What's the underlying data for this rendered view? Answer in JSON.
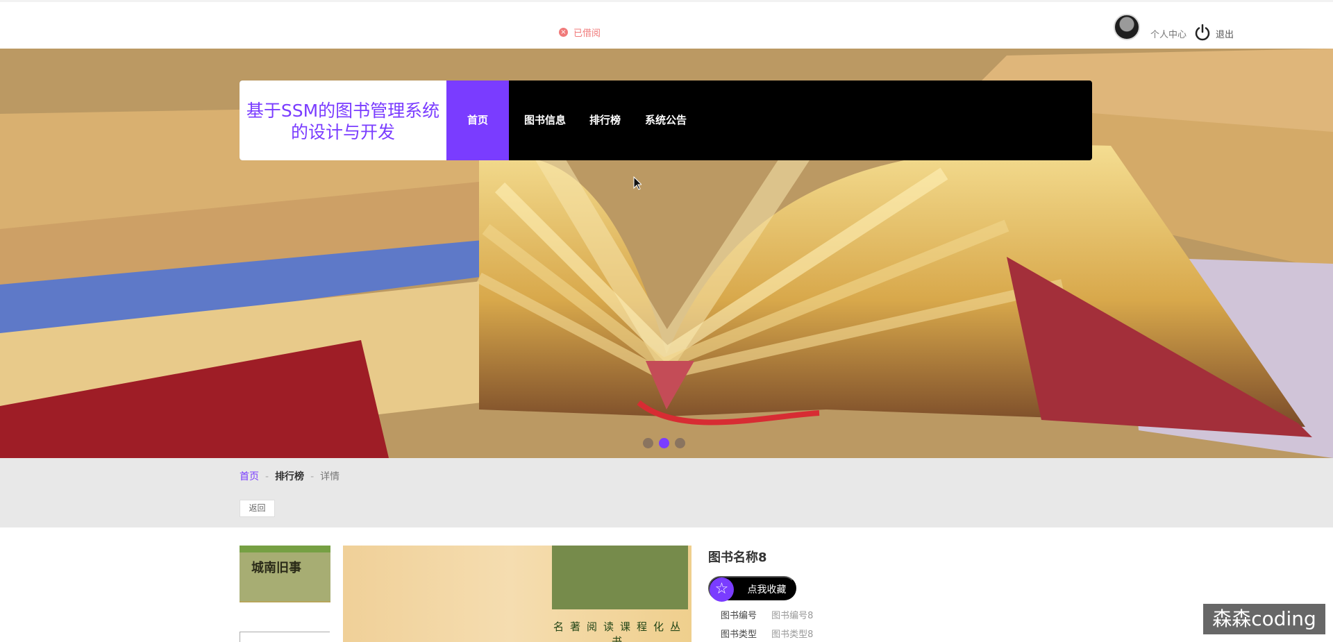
{
  "header": {
    "status_icon": "x-circle-icon",
    "status_text": "已借阅",
    "profile_link": "个人中心",
    "logout_icon": "power-icon",
    "logout_text": "退出"
  },
  "nav": {
    "brand": "基于SSM的图书管理系统的设计与开发",
    "items": [
      {
        "label": "首页"
      },
      {
        "label": "图书信息"
      },
      {
        "label": "排行榜"
      },
      {
        "label": "系统公告"
      }
    ]
  },
  "banner": {
    "carousel_count": 3,
    "active_slide": 2
  },
  "breadcrumb": {
    "items": [
      {
        "label": "首页"
      },
      {
        "label": "排行榜"
      },
      {
        "label": "详情"
      }
    ],
    "separator": "-"
  },
  "actions": {
    "back_label": "返回"
  },
  "book": {
    "thumbnail_title": "城南旧事",
    "main_art_label": "名著阅读课程化丛书",
    "title": "图书名称8",
    "favorite_icon": "star-icon",
    "favorite_label": "点我收藏",
    "fields": [
      {
        "label": "图书编号",
        "value": "图书编号8"
      },
      {
        "label": "图书类型",
        "value": "图书类型8"
      }
    ]
  },
  "watermark": {
    "text": "森森coding"
  },
  "colors": {
    "accent": "#7a3cff",
    "status": "#f07a7a",
    "nav_bg": "#000000",
    "crumb_bg": "#e8e8e8"
  }
}
